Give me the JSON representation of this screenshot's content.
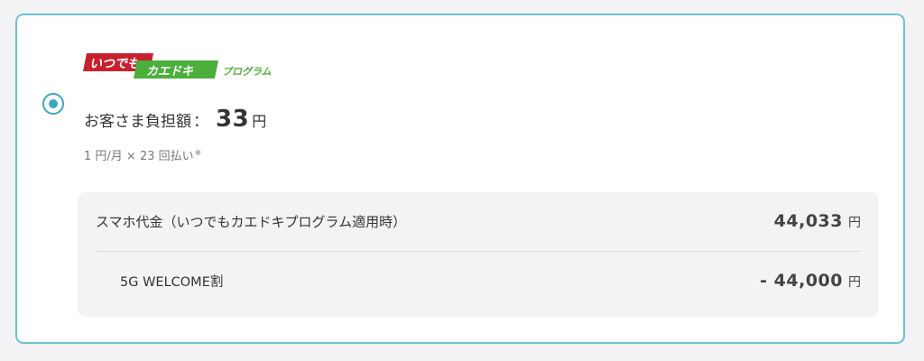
{
  "colors": {
    "border": "#6cc2cf",
    "radio": "#39a7bd",
    "logo_red": "#c8202f",
    "logo_green": "#4caf3b",
    "panel_bg": "#f3f3f5"
  },
  "option": {
    "selected": true,
    "logo": {
      "part1": "いつでも",
      "part2": "カエドキ",
      "part3": "プログラム"
    },
    "burden": {
      "label": "お客さま負担額",
      "colon": "：",
      "amount": "33",
      "unit": "円"
    },
    "installment": {
      "text": "1 円/月 × 23 回払い",
      "note": "※"
    },
    "breakdown": {
      "rows": [
        {
          "label": "スマホ代金（いつでもカエドキプログラム適用時）",
          "amount": "44,033",
          "unit": "円"
        },
        {
          "label": "5G WELCOME割",
          "amount": "- 44,000",
          "unit": "円"
        }
      ]
    }
  }
}
